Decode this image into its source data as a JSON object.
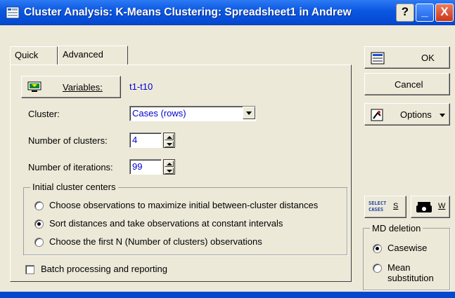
{
  "window": {
    "title": "Cluster Analysis: K-Means Clustering: Spreadsheet1 in Andrew",
    "help_label": "?",
    "minimize_label": "_",
    "close_label": "X"
  },
  "tabs": [
    {
      "label": "Quick",
      "active": false
    },
    {
      "label": "Advanced",
      "active": true
    }
  ],
  "main": {
    "variables_button": "Variables:",
    "variables_value": "t1-t10",
    "cluster_label": "Cluster:",
    "cluster_value": "Cases (rows)",
    "num_clusters_label": "Number of clusters:",
    "num_clusters_value": "4",
    "num_iterations_label": "Number of iterations:",
    "num_iterations_value": "99",
    "initial_centers": {
      "title": "Initial cluster centers",
      "options": [
        {
          "label": "Choose observations to maximize initial between-cluster distances",
          "selected": false
        },
        {
          "label": "Sort distances and take observations at constant intervals",
          "selected": true
        },
        {
          "label": "Choose the first N (Number of clusters) observations",
          "selected": false
        }
      ]
    },
    "batch_label": "Batch processing and reporting",
    "batch_checked": false
  },
  "side": {
    "ok_label": "OK",
    "cancel_label": "Cancel",
    "options_label": "Options",
    "select_cases_icon_text": "SELECT CASES",
    "select_cases_label": "S",
    "weight_label": "W",
    "md_deletion": {
      "title": "MD deletion",
      "options": [
        {
          "label": "Casewise",
          "selected": true
        },
        {
          "label": "Mean substitution",
          "selected": false
        }
      ]
    }
  }
}
